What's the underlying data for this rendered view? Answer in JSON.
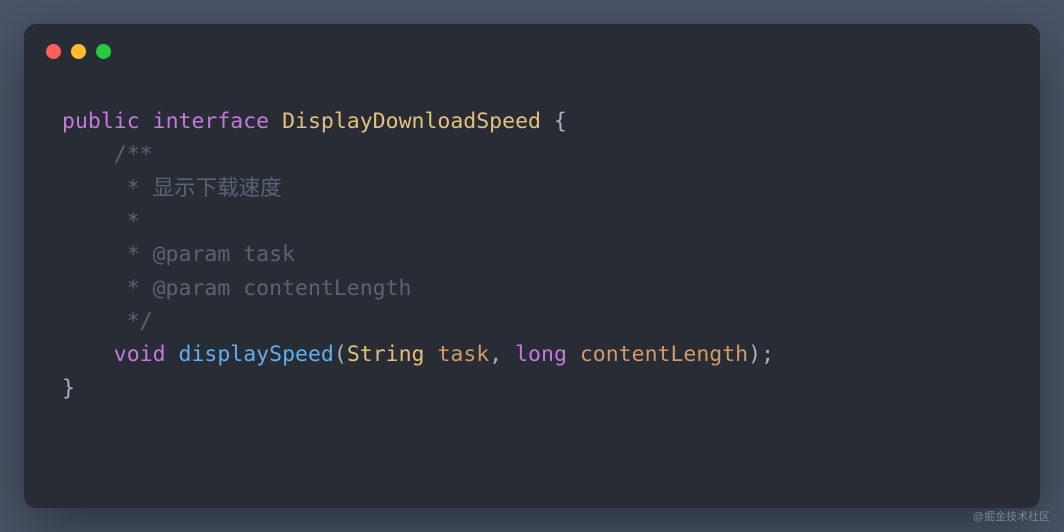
{
  "code": {
    "line1": {
      "kw1": "public",
      "kw2": "interface",
      "type": "DisplayDownloadSpeed",
      "brace": " {"
    },
    "comment": {
      "l1": "    /**",
      "l2": "     * 显示下载速度",
      "l3": "     *",
      "l4": "     * @param task",
      "l5": "     * @param contentLength",
      "l6": "     */"
    },
    "method_line": {
      "indent": "    ",
      "kw_void": "void",
      "method": "displaySpeed",
      "paren_open": "(",
      "type_string": "String",
      "param_task": "task",
      "comma": ", ",
      "kw_long": "long",
      "param_cl": "contentLength",
      "paren_close_semi": ");"
    },
    "close_brace": "}"
  },
  "watermark": "@掘金技术社区"
}
